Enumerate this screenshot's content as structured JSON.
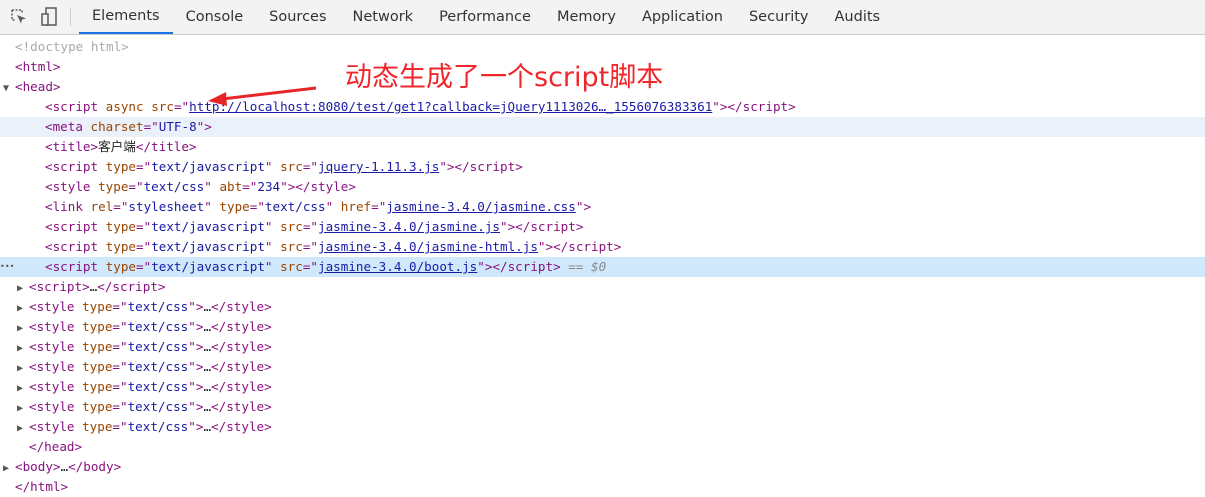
{
  "toolbar": {
    "icons": [
      "inspect-element-icon",
      "device-toolbar-icon"
    ],
    "tabs": [
      "Elements",
      "Console",
      "Sources",
      "Network",
      "Performance",
      "Memory",
      "Application",
      "Security",
      "Audits"
    ],
    "active_tab": "Elements"
  },
  "annotation": {
    "text": "动态生成了一个script脚本",
    "color": "#f0262a"
  },
  "tree": [
    {
      "indent": 0,
      "tokens": [
        [
          "gr",
          "<!doctype html>"
        ]
      ]
    },
    {
      "indent": 0,
      "tokens": [
        [
          "tag",
          "<html>"
        ]
      ]
    },
    {
      "indent": 0,
      "arrow": "open",
      "tokens": [
        [
          "tag",
          "<head>"
        ]
      ]
    },
    {
      "indent": 2,
      "tokens": [
        [
          "tag",
          "<script "
        ],
        [
          "an",
          "async"
        ],
        [
          "tag",
          " "
        ],
        [
          "an",
          "src"
        ],
        [
          "tag",
          "=\""
        ],
        [
          "lk",
          "http://localhost:8080/test/get1?callback=jQuery1113026…_1556076383361"
        ],
        [
          "tag",
          "\"></script>"
        ]
      ]
    },
    {
      "indent": 2,
      "state": "hover",
      "tokens": [
        [
          "tag",
          "<meta "
        ],
        [
          "an",
          "charset"
        ],
        [
          "tag",
          "=\""
        ],
        [
          "av",
          "UTF-8"
        ],
        [
          "tag",
          "\">"
        ]
      ]
    },
    {
      "indent": 2,
      "tokens": [
        [
          "tag",
          "<title>"
        ],
        [
          "tx",
          "客户端"
        ],
        [
          "tag",
          "</title>"
        ]
      ]
    },
    {
      "indent": 2,
      "tokens": [
        [
          "tag",
          "<script "
        ],
        [
          "an",
          "type"
        ],
        [
          "tag",
          "=\""
        ],
        [
          "av",
          "text/javascript"
        ],
        [
          "tag",
          "\" "
        ],
        [
          "an",
          "src"
        ],
        [
          "tag",
          "=\""
        ],
        [
          "lk",
          "jquery-1.11.3.js"
        ],
        [
          "tag",
          "\"></script>"
        ]
      ]
    },
    {
      "indent": 2,
      "tokens": [
        [
          "tag",
          "<style "
        ],
        [
          "an",
          "type"
        ],
        [
          "tag",
          "=\""
        ],
        [
          "av",
          "text/css"
        ],
        [
          "tag",
          "\" "
        ],
        [
          "an",
          "abt"
        ],
        [
          "tag",
          "=\""
        ],
        [
          "av",
          "234"
        ],
        [
          "tag",
          "\"></style>"
        ]
      ]
    },
    {
      "indent": 2,
      "tokens": [
        [
          "tag",
          "<link "
        ],
        [
          "an",
          "rel"
        ],
        [
          "tag",
          "=\""
        ],
        [
          "av",
          "stylesheet"
        ],
        [
          "tag",
          "\" "
        ],
        [
          "an",
          "type"
        ],
        [
          "tag",
          "=\""
        ],
        [
          "av",
          "text/css"
        ],
        [
          "tag",
          "\" "
        ],
        [
          "an",
          "href"
        ],
        [
          "tag",
          "=\""
        ],
        [
          "lk",
          "jasmine-3.4.0/jasmine.css"
        ],
        [
          "tag",
          "\">"
        ]
      ]
    },
    {
      "indent": 2,
      "tokens": [
        [
          "tag",
          "<script "
        ],
        [
          "an",
          "type"
        ],
        [
          "tag",
          "=\""
        ],
        [
          "av",
          "text/javascript"
        ],
        [
          "tag",
          "\" "
        ],
        [
          "an",
          "src"
        ],
        [
          "tag",
          "=\""
        ],
        [
          "lk",
          "jasmine-3.4.0/jasmine.js"
        ],
        [
          "tag",
          "\"></script>"
        ]
      ]
    },
    {
      "indent": 2,
      "tokens": [
        [
          "tag",
          "<script "
        ],
        [
          "an",
          "type"
        ],
        [
          "tag",
          "=\""
        ],
        [
          "av",
          "text/javascript"
        ],
        [
          "tag",
          "\" "
        ],
        [
          "an",
          "src"
        ],
        [
          "tag",
          "=\""
        ],
        [
          "lk",
          "jasmine-3.4.0/jasmine-html.js"
        ],
        [
          "tag",
          "\"></script>"
        ]
      ]
    },
    {
      "indent": 2,
      "state": "selected",
      "tokens": [
        [
          "tag",
          "<script "
        ],
        [
          "an",
          "type"
        ],
        [
          "tag",
          "=\""
        ],
        [
          "av",
          "text/javascript"
        ],
        [
          "tag",
          "\" "
        ],
        [
          "an",
          "src"
        ],
        [
          "tag",
          "=\""
        ],
        [
          "lk",
          "jasmine-3.4.0/boot.js"
        ],
        [
          "tag",
          "\"></script>"
        ],
        [
          "ref",
          " == $0"
        ]
      ]
    },
    {
      "indent": 1,
      "arrow": "closed",
      "tokens": [
        [
          "tag",
          "<script>"
        ],
        [
          "tx",
          "…"
        ],
        [
          "tag",
          "</script>"
        ]
      ]
    },
    {
      "indent": 1,
      "arrow": "closed",
      "tokens": [
        [
          "tag",
          "<style "
        ],
        [
          "an",
          "type"
        ],
        [
          "tag",
          "=\""
        ],
        [
          "av",
          "text/css"
        ],
        [
          "tag",
          "\">"
        ],
        [
          "tx",
          "…"
        ],
        [
          "tag",
          "</style>"
        ]
      ]
    },
    {
      "indent": 1,
      "arrow": "closed",
      "tokens": [
        [
          "tag",
          "<style "
        ],
        [
          "an",
          "type"
        ],
        [
          "tag",
          "=\""
        ],
        [
          "av",
          "text/css"
        ],
        [
          "tag",
          "\">"
        ],
        [
          "tx",
          "…"
        ],
        [
          "tag",
          "</style>"
        ]
      ]
    },
    {
      "indent": 1,
      "arrow": "closed",
      "tokens": [
        [
          "tag",
          "<style "
        ],
        [
          "an",
          "type"
        ],
        [
          "tag",
          "=\""
        ],
        [
          "av",
          "text/css"
        ],
        [
          "tag",
          "\">"
        ],
        [
          "tx",
          "…"
        ],
        [
          "tag",
          "</style>"
        ]
      ]
    },
    {
      "indent": 1,
      "arrow": "closed",
      "tokens": [
        [
          "tag",
          "<style "
        ],
        [
          "an",
          "type"
        ],
        [
          "tag",
          "=\""
        ],
        [
          "av",
          "text/css"
        ],
        [
          "tag",
          "\">"
        ],
        [
          "tx",
          "…"
        ],
        [
          "tag",
          "</style>"
        ]
      ]
    },
    {
      "indent": 1,
      "arrow": "closed",
      "tokens": [
        [
          "tag",
          "<style "
        ],
        [
          "an",
          "type"
        ],
        [
          "tag",
          "=\""
        ],
        [
          "av",
          "text/css"
        ],
        [
          "tag",
          "\">"
        ],
        [
          "tx",
          "…"
        ],
        [
          "tag",
          "</style>"
        ]
      ]
    },
    {
      "indent": 1,
      "arrow": "closed",
      "tokens": [
        [
          "tag",
          "<style "
        ],
        [
          "an",
          "type"
        ],
        [
          "tag",
          "=\""
        ],
        [
          "av",
          "text/css"
        ],
        [
          "tag",
          "\">"
        ],
        [
          "tx",
          "…"
        ],
        [
          "tag",
          "</style>"
        ]
      ]
    },
    {
      "indent": 1,
      "arrow": "closed",
      "tokens": [
        [
          "tag",
          "<style "
        ],
        [
          "an",
          "type"
        ],
        [
          "tag",
          "=\""
        ],
        [
          "av",
          "text/css"
        ],
        [
          "tag",
          "\">"
        ],
        [
          "tx",
          "…"
        ],
        [
          "tag",
          "</style>"
        ]
      ]
    },
    {
      "indent": 1,
      "closing": true,
      "tokens": [
        [
          "tag",
          "</head>"
        ]
      ]
    },
    {
      "indent": 0,
      "arrow": "closed",
      "tokens": [
        [
          "tag",
          "<body>"
        ],
        [
          "tx",
          "…"
        ],
        [
          "tag",
          "</body>"
        ]
      ]
    },
    {
      "indent": 0,
      "tokens": [
        [
          "tag",
          "</html>"
        ]
      ]
    }
  ]
}
